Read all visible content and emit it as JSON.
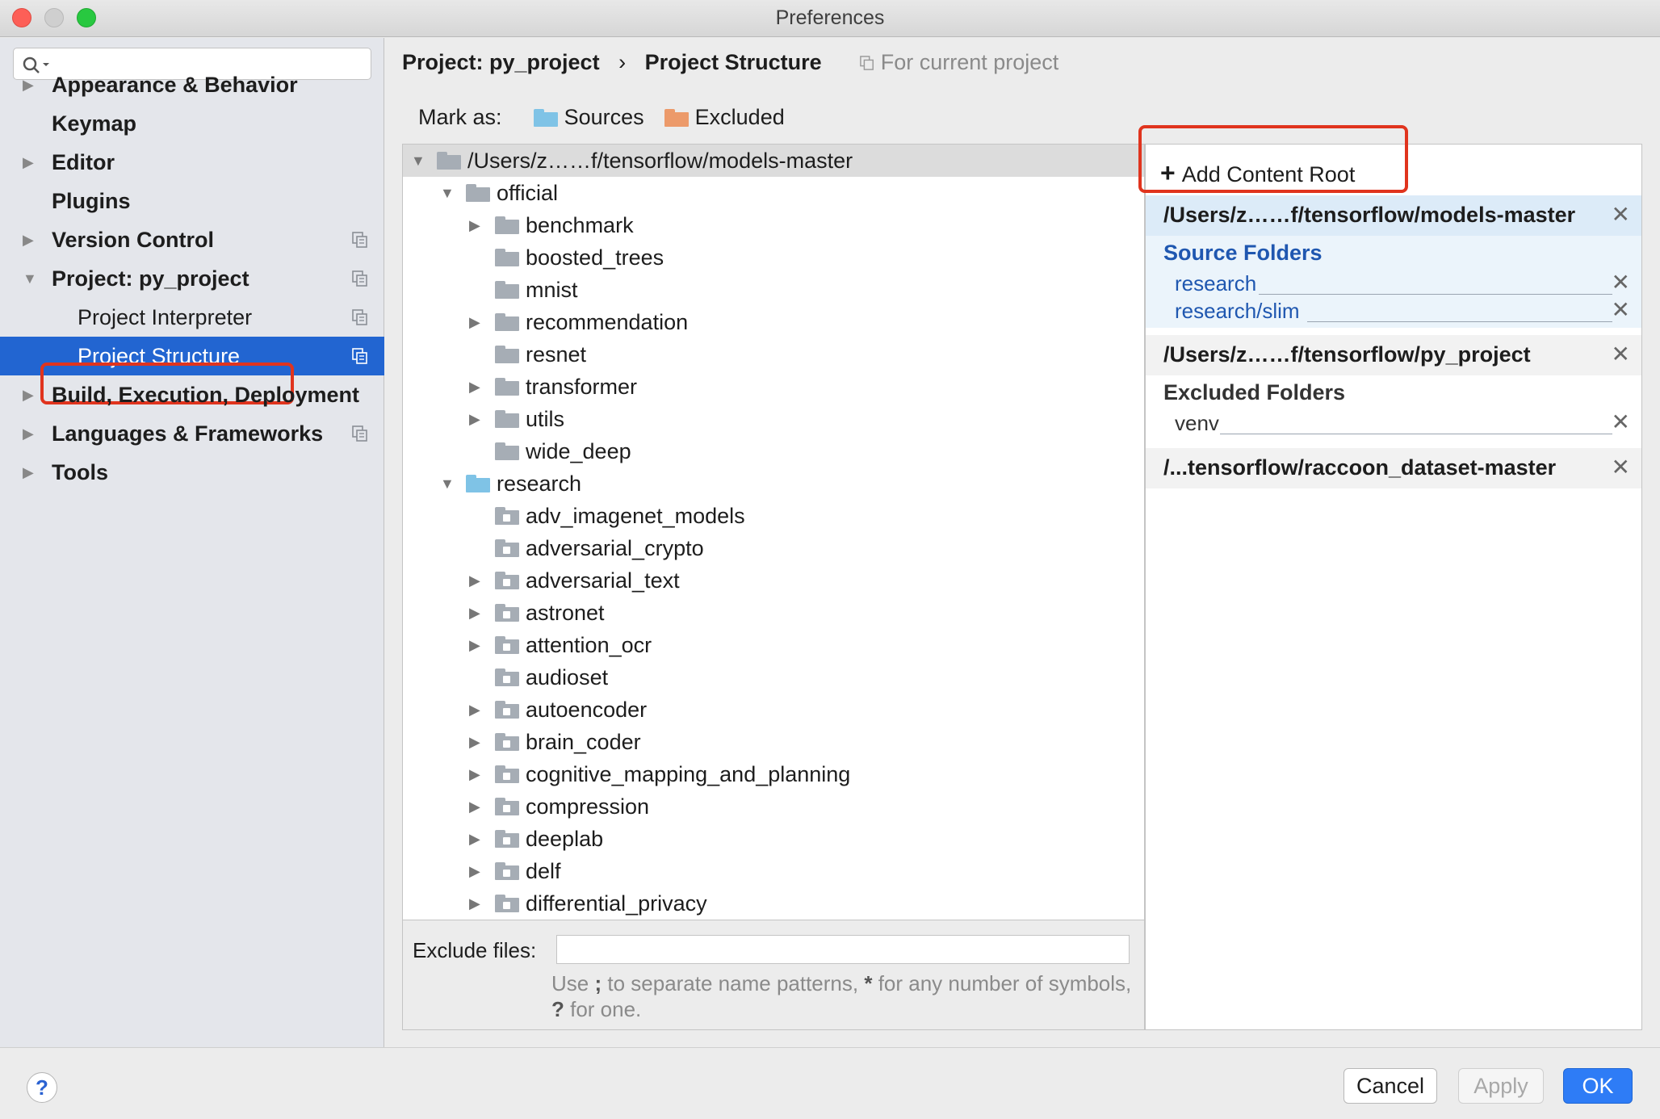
{
  "window": {
    "title": "Preferences"
  },
  "sidebar": {
    "search_placeholder": "",
    "items": [
      {
        "label": "Appearance & Behavior"
      },
      {
        "label": "Keymap"
      },
      {
        "label": "Editor"
      },
      {
        "label": "Plugins"
      },
      {
        "label": "Version Control"
      },
      {
        "label": "Project: py_project"
      },
      {
        "label": "Project Interpreter"
      },
      {
        "label": "Project Structure"
      },
      {
        "label": "Build, Execution, Deployment"
      },
      {
        "label": "Languages & Frameworks"
      },
      {
        "label": "Tools"
      }
    ]
  },
  "header": {
    "breadcrumb_project": "Project: py_project",
    "breadcrumb_sep": "›",
    "breadcrumb_page": "Project Structure",
    "scope_note": "For current project"
  },
  "mark_as": {
    "label": "Mark as:",
    "sources": "Sources",
    "excluded": "Excluded"
  },
  "tree": {
    "rows": [
      {
        "label": "/Users/z……f/tensorflow/models-master"
      },
      {
        "label": "official"
      },
      {
        "label": "benchmark"
      },
      {
        "label": "boosted_trees"
      },
      {
        "label": "mnist"
      },
      {
        "label": "recommendation"
      },
      {
        "label": "resnet"
      },
      {
        "label": "transformer"
      },
      {
        "label": "utils"
      },
      {
        "label": "wide_deep"
      },
      {
        "label": "research"
      },
      {
        "label": "adv_imagenet_models"
      },
      {
        "label": "adversarial_crypto"
      },
      {
        "label": "adversarial_text"
      },
      {
        "label": "astronet"
      },
      {
        "label": "attention_ocr"
      },
      {
        "label": "audioset"
      },
      {
        "label": "autoencoder"
      },
      {
        "label": "brain_coder"
      },
      {
        "label": "cognitive_mapping_and_planning"
      },
      {
        "label": "compression"
      },
      {
        "label": "deeplab"
      },
      {
        "label": "delf"
      },
      {
        "label": "differential_privacy"
      }
    ]
  },
  "exclude": {
    "label": "Exclude files:",
    "value": "",
    "hint_pre": "Use ",
    "hint_semicolon": ";",
    "hint_mid": " to separate name patterns, ",
    "hint_star": "*",
    "hint_mid2": " for any number of symbols, ",
    "hint_q": "?",
    "hint_post": " for one."
  },
  "content_roots": {
    "add_label": "Add Content Root",
    "roots": [
      {
        "path": "/Users/z……f/tensorflow/models-master",
        "section_title": "Source Folders",
        "folders": [
          "research",
          "research/slim"
        ]
      },
      {
        "path": "/Users/z……f/tensorflow/py_project",
        "section_title": "Excluded Folders",
        "folders": [
          "venv"
        ]
      },
      {
        "path": "/...tensorflow/raccoon_dataset-master"
      }
    ]
  },
  "buttons": {
    "help": "?",
    "cancel": "Cancel",
    "apply": "Apply",
    "ok": "OK"
  },
  "colors": {
    "accent": "#2265d1",
    "highlight_box": "#e0341e",
    "source_blue": "#1f57b0"
  }
}
